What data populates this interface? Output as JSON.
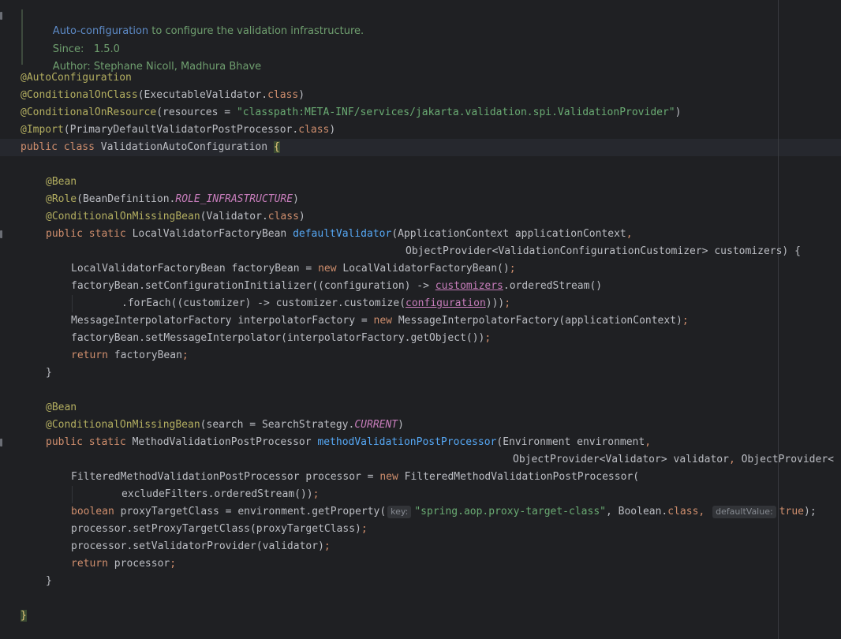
{
  "doc": {
    "link_text": "Auto-configuration",
    "summary_rest": " to configure the validation infrastructure.",
    "since_label": "Since:",
    "since_value": "1.5.0",
    "author_label": "Author:",
    "author_value": "Stephane Nicoll, Madhura Bhave"
  },
  "code": {
    "l1": "@AutoConfiguration",
    "l2a": "@ConditionalOnClass",
    "l2b": "(ExecutableValidator.",
    "l2c": "class",
    "l2d": ")",
    "l3a": "@ConditionalOnResource",
    "l3b": "(resources = ",
    "l3c": "\"classpath:META-INF/services/jakarta.validation.spi.ValidationProvider\"",
    "l3d": ")",
    "l4a": "@Import",
    "l4b": "(PrimaryDefaultValidatorPostProcessor.",
    "l4c": "class",
    "l4d": ")",
    "l5a": "public class ",
    "l5b": "ValidationAutoConfiguration ",
    "l5c": "{",
    "l7": "@Bean",
    "l8a": "@Role",
    "l8b": "(BeanDefinition.",
    "l8c": "ROLE_INFRASTRUCTURE",
    "l8d": ")",
    "l9a": "@ConditionalOnMissingBean",
    "l9b": "(Validator.",
    "l9c": "class",
    "l9d": ")",
    "l10a": "public static ",
    "l10b": "LocalValidatorFactoryBean ",
    "l10c": "defaultValidator",
    "l10d": "(ApplicationContext applicationContext",
    "l10e": ",",
    "l11": "ObjectProvider<ValidationConfigurationCustomizer> customizers) {",
    "l12a": "LocalValidatorFactoryBean factoryBean = ",
    "l12b": "new ",
    "l12c": "LocalValidatorFactoryBean()",
    "l12d": ";",
    "l13a": "factoryBean.setConfigurationInitializer((configuration) -> ",
    "l13b": "customizers",
    "l13c": ".orderedStream()",
    "l14a": ".forEach((customizer) -> customizer.customize(",
    "l14b": "configuration",
    "l14c": ")))",
    "l14d": ";",
    "l15a": "MessageInterpolatorFactory interpolatorFactory = ",
    "l15b": "new ",
    "l15c": "MessageInterpolatorFactory(applicationContext)",
    "l15d": ";",
    "l16a": "factoryBean.setMessageInterpolator(interpolatorFactory.getObject())",
    "l16b": ";",
    "l17a": "return ",
    "l17b": "factoryBean",
    "l17c": ";",
    "l18": "}",
    "l20": "@Bean",
    "l21a": "@ConditionalOnMissingBean",
    "l21b": "(search = SearchStrategy.",
    "l21c": "CURRENT",
    "l21d": ")",
    "l22a": "public static ",
    "l22b": "MethodValidationPostProcessor ",
    "l22c": "methodValidationPostProcessor",
    "l22d": "(Environment environment",
    "l22e": ",",
    "l23a": "ObjectProvider<Validator> validator",
    "l23b": ", ",
    "l23c": "ObjectProvider<",
    "l24a": "FilteredMethodValidationPostProcessor processor = ",
    "l24b": "new ",
    "l24c": "FilteredMethodValidationPostProcessor(",
    "l25a": "excludeFilters.orderedStream())",
    "l25b": ";",
    "l26a": "boolean ",
    "l26b": "proxyTargetClass = environment.getProperty(",
    "l26hint1": "key:",
    "l26c": "\"spring.aop.proxy-target-class\"",
    "l26d": ", Boolean.",
    "l26e": "class",
    "l26f": ", ",
    "l26hint2": "defaultValue:",
    "l26g": "true",
    "l26h": ");",
    "l27a": "processor.setProxyTargetClass(proxyTargetClass)",
    "l27b": ";",
    "l28a": "processor.setValidatorProvider(validator)",
    "l28b": ";",
    "l29a": "return ",
    "l29b": "processor",
    "l29c": ";",
    "l30": "}",
    "l32": "}"
  }
}
